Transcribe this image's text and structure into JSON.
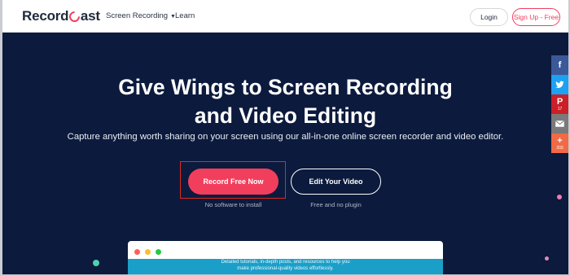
{
  "header": {
    "logo": {
      "part1": "Record",
      "part2": "ast"
    },
    "nav": [
      {
        "label": "Screen Recording"
      },
      {
        "label": "Learn"
      }
    ],
    "login_label": "Login",
    "signup_label": "Sign Up - Free"
  },
  "hero": {
    "title_line1": "Give Wings to Screen Recording",
    "title_line2": "and Video Editing",
    "subtitle": "Capture anything worth sharing on your screen using our all-in-one online screen recorder and video editor.",
    "record_label": "Record Free Now",
    "record_caption": "No software to install",
    "edit_label": "Edit Your Video",
    "edit_caption": "Free and no plugin"
  },
  "preview": {
    "text_line1": "Detailed tutorials, in-depth posts, and resources to help you",
    "text_line2": "make professional-quality videos effortlessly."
  },
  "share": {
    "pinterest_count": "17",
    "plus_count": "203"
  },
  "colors": {
    "accent": "#f23e5d",
    "hero_bg": "#0c1a3d",
    "facebook": "#3b5998",
    "twitter": "#1da1f2",
    "pinterest": "#cb2027",
    "email": "#7a7a7a",
    "share_more": "#f16a45"
  }
}
